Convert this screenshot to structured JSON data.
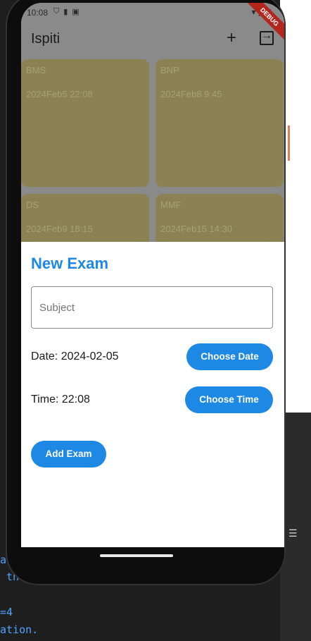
{
  "status": {
    "time": "10:08",
    "icons": [
      "wifi-icon",
      "signal-icon",
      "battery-icon"
    ],
    "debug": "DEBUG"
  },
  "app": {
    "title": "Ispiti"
  },
  "exams": [
    {
      "name": "BMS",
      "date": "2024Feb5 22:08"
    },
    {
      "name": "BNP",
      "date": "2024Feb8 9:45"
    },
    {
      "name": "DS",
      "date": "2024Feb9 18:15"
    },
    {
      "name": "MMF",
      "date": "2024Feb15 14:30"
    }
  ],
  "sheet": {
    "title": "New Exam",
    "subject_placeholder": "Subject",
    "date_label": "Date: 2024-02-05",
    "time_label": "Time: 22:08",
    "choose_date": "Choose Date",
    "choose_time": "Choose Time",
    "add_exam": "Add Exam"
  },
  "ide": {
    "lines": [
      "a",
      " th",
      "=4",
      "ation."
    ]
  },
  "colors": {
    "accent": "#1e88e5",
    "card": "#8b8152"
  }
}
